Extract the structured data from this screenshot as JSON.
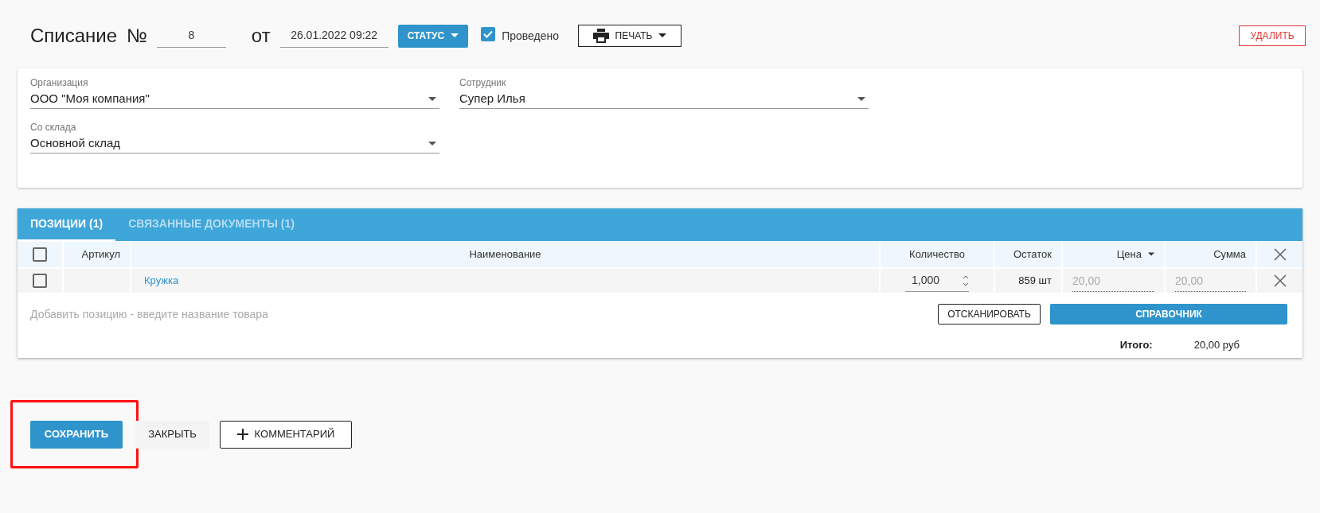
{
  "header": {
    "title": "Списание",
    "number_label": "№",
    "number": "8",
    "date_label": "от",
    "date": "26.01.2022 09:22",
    "status_button": "СТАТУС",
    "posted": {
      "label": "Проведено",
      "checked": true
    },
    "print_button": "ПЕЧАТЬ",
    "delete_button": "УДАЛИТЬ"
  },
  "fields": [
    {
      "label": "Организация",
      "value": "ООО \"Моя компания\""
    },
    {
      "label": "Сотрудник",
      "value": "Супер Илья"
    },
    {
      "label": "Со склада",
      "value": "Основной склад"
    }
  ],
  "tabs": [
    {
      "label": "ПОЗИЦИИ (1)",
      "selected": true
    },
    {
      "label": "СВЯЗАННЫЕ ДОКУМЕНТЫ (1)",
      "selected": false
    }
  ],
  "table": {
    "columns": [
      "Артикул",
      "Наименование",
      "Количество",
      "Остаток",
      "Цена",
      "Сумма"
    ],
    "header_checked": false,
    "rows": [
      {
        "checked": false,
        "article": "",
        "name": "Кружка",
        "quantity": "1,000",
        "stock": "859 шт",
        "price": "20,00",
        "sum": "20,00"
      }
    ]
  },
  "add_placeholder": "Добавить позицию - введите название товара",
  "scan_button": "ОТСКАНИРОВАТЬ",
  "catalog_button": "СПРАВОЧНИК",
  "total": {
    "label": "Итого:",
    "value": "20,00 руб"
  },
  "footer": {
    "save_button": "СОХРАНИТЬ",
    "save_highlighted": true,
    "close_button": "ЗАКРЫТЬ",
    "comment_button": "КОММЕНТАРИЙ"
  }
}
